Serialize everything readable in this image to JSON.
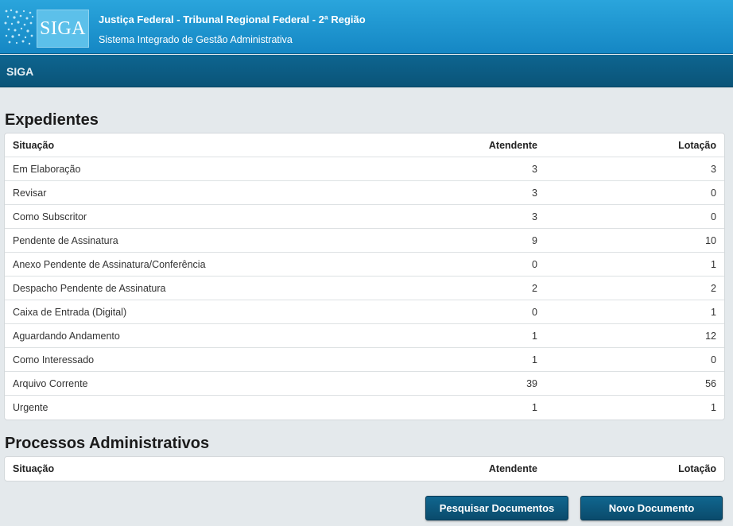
{
  "header": {
    "logo_text": "SIGA",
    "title": "Justiça Federal - Tribunal Regional Federal - 2ª Região",
    "subtitle": "Sistema Integrado de Gestão Administrativa"
  },
  "navbar": {
    "brand": "SIGA"
  },
  "expedientes": {
    "title": "Expedientes",
    "columns": [
      "Situação",
      "Atendente",
      "Lotação"
    ],
    "rows": [
      {
        "situacao": "Em Elaboração",
        "atendente": "3",
        "lotacao": "3"
      },
      {
        "situacao": "Revisar",
        "atendente": "3",
        "lotacao": "0"
      },
      {
        "situacao": "Como Subscritor",
        "atendente": "3",
        "lotacao": "0"
      },
      {
        "situacao": "Pendente de Assinatura",
        "atendente": "9",
        "lotacao": "10"
      },
      {
        "situacao": "Anexo Pendente de Assinatura/Conferência",
        "atendente": "0",
        "lotacao": "1"
      },
      {
        "situacao": "Despacho Pendente de Assinatura",
        "atendente": "2",
        "lotacao": "2"
      },
      {
        "situacao": "Caixa de Entrada (Digital)",
        "atendente": "0",
        "lotacao": "1"
      },
      {
        "situacao": "Aguardando Andamento",
        "atendente": "1",
        "lotacao": "12"
      },
      {
        "situacao": "Como Interessado",
        "atendente": "1",
        "lotacao": "0"
      },
      {
        "situacao": "Arquivo Corrente",
        "atendente": "39",
        "lotacao": "56"
      },
      {
        "situacao": "Urgente",
        "atendente": "1",
        "lotacao": "1"
      }
    ]
  },
  "processos": {
    "title": "Processos Administrativos",
    "columns": [
      "Situação",
      "Atendente",
      "Lotação"
    ]
  },
  "actions": {
    "search_label": "Pesquisar Documentos",
    "new_label": "Novo Documento"
  }
}
